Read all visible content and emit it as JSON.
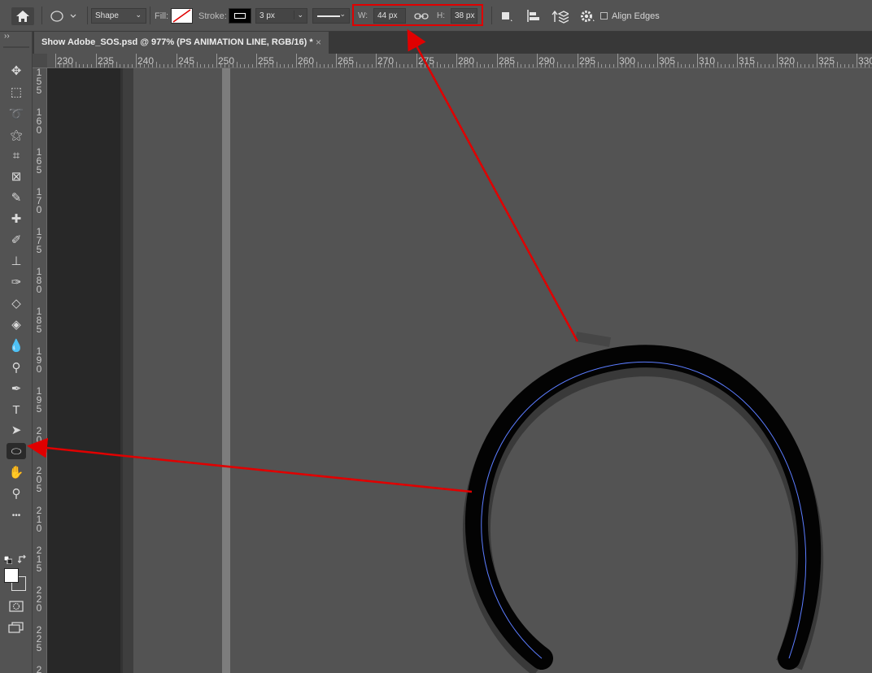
{
  "options_bar": {
    "mode_label": "Shape",
    "fill_label": "Fill:",
    "stroke_label": "Stroke:",
    "stroke_width": "3 px",
    "w_label": "W:",
    "w_value": "44 px",
    "h_label": "H:",
    "h_value": "38 px",
    "align_edges_label": "Align Edges",
    "highlight_color": "#e00000"
  },
  "document_tab": {
    "title": "Show Adobe_SOS.psd @ 977% (PS ANIMATION LINE, RGB/16) *",
    "close_glyph": "×"
  },
  "ruler_top": [
    "230",
    "235",
    "240",
    "245",
    "250",
    "255",
    "260",
    "265",
    "270",
    "275",
    "280",
    "285",
    "290",
    "295",
    "300",
    "305",
    "310",
    "315",
    "320",
    "325",
    "330"
  ],
  "ruler_left": [
    [
      "1",
      "5",
      "5"
    ],
    [
      "1",
      "6",
      "0"
    ],
    [
      "1",
      "6",
      "5"
    ],
    [
      "1",
      "7",
      "0"
    ],
    [
      "1",
      "7",
      "5"
    ],
    [
      "1",
      "8",
      "0"
    ],
    [
      "1",
      "8",
      "5"
    ],
    [
      "1",
      "9",
      "0"
    ],
    [
      "1",
      "9",
      "5"
    ],
    [
      "2",
      "0",
      "0"
    ],
    [
      "2",
      "0",
      "5"
    ],
    [
      "2",
      "1",
      "0"
    ],
    [
      "2",
      "1",
      "5"
    ],
    [
      "2",
      "2",
      "0"
    ],
    [
      "2",
      "2",
      "5"
    ],
    [
      "2"
    ]
  ],
  "toolbar_expand": "››",
  "tools": [
    {
      "name": "move-tool-icon",
      "glyph": "✥"
    },
    {
      "name": "marquee-tool-icon",
      "glyph": "⬚"
    },
    {
      "name": "lasso-tool-icon",
      "glyph": "➰"
    },
    {
      "name": "magic-wand-tool-icon",
      "glyph": "⚝"
    },
    {
      "name": "crop-tool-icon",
      "glyph": "⌗"
    },
    {
      "name": "frame-tool-icon",
      "glyph": "⊠"
    },
    {
      "name": "eyedropper-tool-icon",
      "glyph": "✎"
    },
    {
      "name": "healing-brush-tool-icon",
      "glyph": "✚"
    },
    {
      "name": "brush-tool-icon",
      "glyph": "✐"
    },
    {
      "name": "clone-stamp-tool-icon",
      "glyph": "⊥"
    },
    {
      "name": "history-brush-tool-icon",
      "glyph": "✑"
    },
    {
      "name": "eraser-tool-icon",
      "glyph": "◇"
    },
    {
      "name": "paint-bucket-tool-icon",
      "glyph": "◈"
    },
    {
      "name": "blur-tool-icon",
      "glyph": "💧"
    },
    {
      "name": "dodge-tool-icon",
      "glyph": "⚲"
    },
    {
      "name": "pen-tool-icon",
      "glyph": "✒"
    },
    {
      "name": "type-tool-icon",
      "glyph": "T"
    },
    {
      "name": "path-selection-tool-icon",
      "glyph": "➤"
    },
    {
      "name": "ellipse-tool-icon",
      "glyph": "⬭"
    },
    {
      "name": "hand-tool-icon",
      "glyph": "✋"
    },
    {
      "name": "zoom-tool-icon",
      "glyph": "⚲"
    },
    {
      "name": "edit-toolbar-icon",
      "glyph": "•••"
    }
  ],
  "colors": {
    "canvas_gray": "#535353",
    "annotation_red": "#e00000",
    "path_blue": "#5b7cff"
  }
}
